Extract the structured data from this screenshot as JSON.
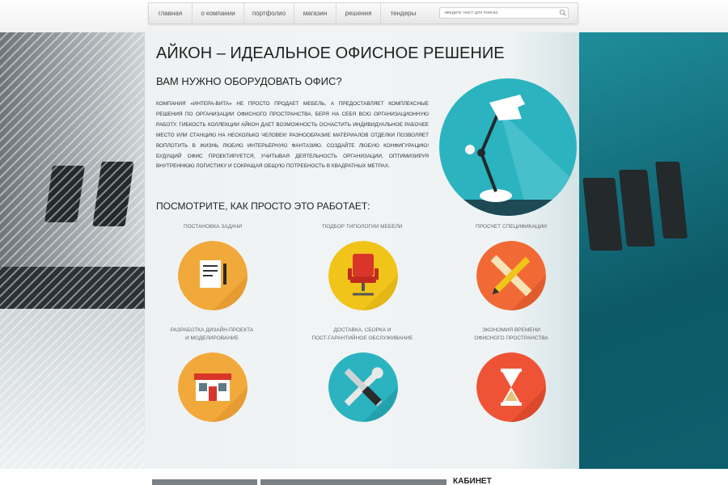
{
  "nav": {
    "items": [
      {
        "label": "главная"
      },
      {
        "label": "о компании"
      },
      {
        "label": "портфолио"
      },
      {
        "label": "магазин"
      },
      {
        "label": "решения"
      },
      {
        "label": "тендеры"
      }
    ],
    "search_placeholder": "введите текст для поиска"
  },
  "main": {
    "title": "АЙКОН – ИДЕАЛЬНОЕ ОФИСНОЕ РЕШЕНИЕ",
    "subtitle": "ВАМ НУЖНО ОБОРУДОВАТЬ ОФИС?",
    "paragraph": "Компания «Интера-Вита» не просто продает мебель, а предоставляет комплексные решения по организации офисного пространства, беря на себя всю организационную работу. Гибкость коллекции Айкон дает возможность оснастить индивидуальное рабочее место или станцию на несколько человек! Разнообразие материалов отделки позволяет воплотить в жизнь любую интерьерную фантазию. Создайте любую конфигурацию! Будущий офис проектируется, учитывая деятельность организации, оптимизируя внутреннюю логистику и сокращая общую потребность в квадратных метрах.",
    "howto": "ПОСМОТРИТЕ, КАК ПРОСТО ЭТО РАБОТАЕТ:"
  },
  "steps": [
    {
      "label": "Постановка задачи",
      "icon": "document-icon",
      "color": "#f2a93b"
    },
    {
      "label": "Подбор типологии мебели",
      "icon": "office-chair-icon",
      "color": "#f0c419"
    },
    {
      "label": "Просчет спецификации",
      "icon": "pencil-ruler-icon",
      "color": "#f16a36"
    },
    {
      "label": "Разработка дизайн-проекта\nи моделирование",
      "icon": "storefront-icon",
      "color": "#f2a93b"
    },
    {
      "label": "Доставка, сборка и\nпост-гарантийное обслуживание",
      "icon": "wrench-screwdriver-icon",
      "color": "#2bb3c0"
    },
    {
      "label": "Экономия времени\nофисного пространства",
      "icon": "hourglass-icon",
      "color": "#ef5336"
    }
  ],
  "illustration": {
    "icon": "desk-lamp-icon",
    "color": "#2bb3c0"
  },
  "bottom": {
    "cabinet_label": "КАБИНЕТ"
  },
  "colors": {
    "accent_teal": "#2bb3c0",
    "wall_teal": "#0f5f6c",
    "panel": "#f2f6f7"
  }
}
